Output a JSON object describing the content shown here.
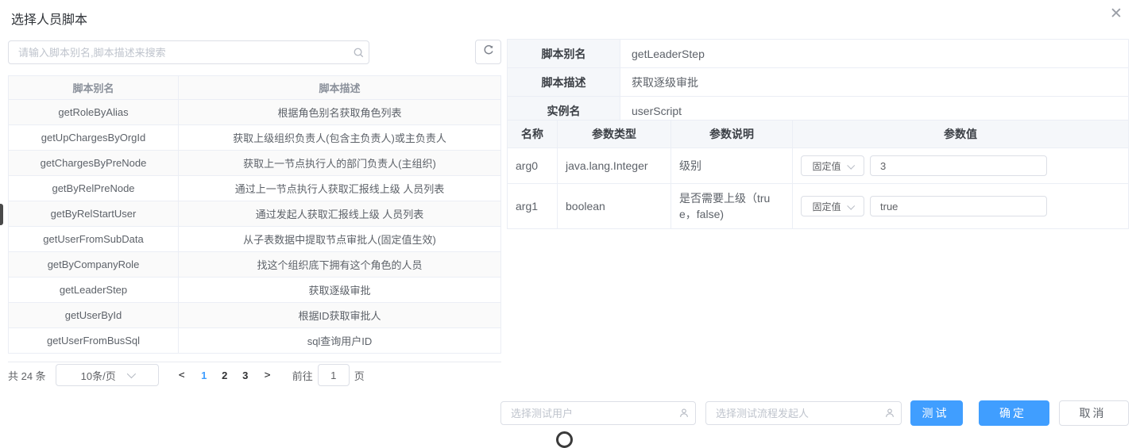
{
  "colors": {
    "accent": "#409eff",
    "table_border": "#ebeef5",
    "control_border": "#dcdfe6",
    "header_bg": "#f5f7fa",
    "stripe_bg": "#fafafa",
    "text": "#606266"
  },
  "dialog": {
    "title": "选择人员脚本",
    "close_glyph": "✕"
  },
  "search": {
    "placeholder": "请输入脚本别名,脚本描述来搜索",
    "icon": "search-icon"
  },
  "toolbar": {
    "refresh_icon": "refresh-circular-arrow-icon"
  },
  "script_table": {
    "columns": [
      "脚本别名",
      "脚本描述"
    ],
    "rows": [
      {
        "alias": "getRoleByAlias",
        "desc": "根据角色别名获取角色列表"
      },
      {
        "alias": "getUpChargesByOrgId",
        "desc": "获取上级组织负责人(包含主负责人)或主负责人"
      },
      {
        "alias": "getChargesByPreNode",
        "desc": "获取上一节点执行人的部门负责人(主组织)"
      },
      {
        "alias": "getByRelPreNode",
        "desc": "通过上一节点执行人获取汇报线上级 人员列表"
      },
      {
        "alias": "getByRelStartUser",
        "desc": "通过发起人获取汇报线上级 人员列表"
      },
      {
        "alias": "getUserFromSubData",
        "desc": "从子表数据中提取节点审批人(固定值生效)"
      },
      {
        "alias": "getByCompanyRole",
        "desc": "找这个组织底下拥有这个角色的人员"
      },
      {
        "alias": "getLeaderStep",
        "desc": "获取逐级审批"
      },
      {
        "alias": "getUserById",
        "desc": "根据ID获取审批人"
      },
      {
        "alias": "getUserFromBusSql",
        "desc": "sql查询用户ID"
      }
    ]
  },
  "pagination": {
    "total": "共 24 条",
    "page_size": "10条/页",
    "prev": "<",
    "pages": [
      "1",
      "2",
      "3"
    ],
    "active_page": "1",
    "next": ">",
    "goto_label": "前往",
    "goto_value": "1",
    "goto_suffix": "页"
  },
  "detail": {
    "rows": [
      {
        "label": "脚本别名",
        "value": "getLeaderStep"
      },
      {
        "label": "脚本描述",
        "value": "获取逐级审批"
      },
      {
        "label": "实例名",
        "value": "userScript"
      }
    ]
  },
  "params": {
    "columns": [
      "名称",
      "参数类型",
      "参数说明",
      "参数值"
    ],
    "rows": [
      {
        "name": "arg0",
        "type": "java.lang.Integer",
        "desc": "级别",
        "value_mode": "固定值",
        "value": "3"
      },
      {
        "name": "arg1",
        "type": "boolean",
        "desc": "是否需要上级（true，false)",
        "value_mode": "固定值",
        "value": "true"
      }
    ]
  },
  "footer": {
    "test_user_placeholder": "选择测试用户",
    "initiator_placeholder": "选择测试流程发起人",
    "user_icon": "person-silhouette-icon",
    "test_button": "测试",
    "confirm_button": "确定",
    "cancel_button": "取消"
  }
}
